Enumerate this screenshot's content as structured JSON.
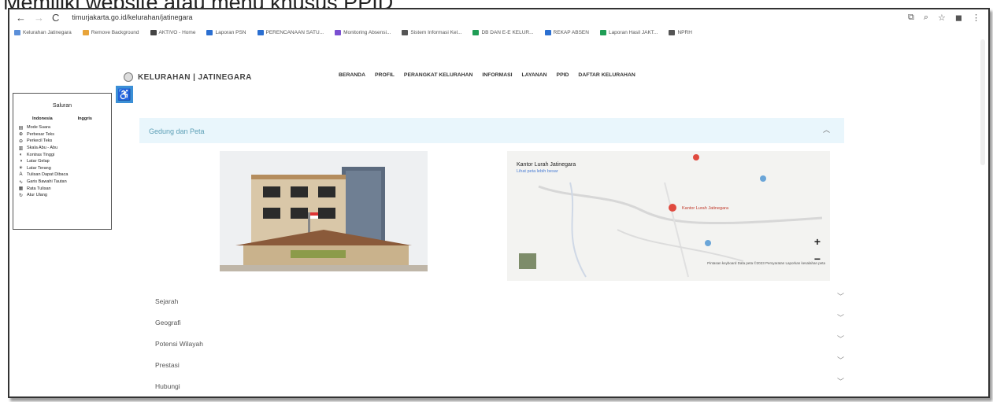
{
  "slide": {
    "title": "Memiliki website atau menu khusus PPID"
  },
  "browser": {
    "url": "timurjakarta.go.id/kelurahan/jatinegara",
    "bookmarks": [
      {
        "label": "Kelurahan Jatinegara",
        "color": "#5b8fd9"
      },
      {
        "label": "Remove Background",
        "color": "#e8a43a"
      },
      {
        "label": "AKTIVO - Home",
        "color": "#444444"
      },
      {
        "label": "Laporan PSN",
        "color": "#2b6fd1"
      },
      {
        "label": "PERENCANAAN SATU...",
        "color": "#2b6fd1"
      },
      {
        "label": "Monitoring Absensi...",
        "color": "#7a4fd1"
      },
      {
        "label": "Sistem Informasi Kel...",
        "color": "#555555"
      },
      {
        "label": "DB DAN E-E KELUR...",
        "color": "#1f9d55"
      },
      {
        "label": "REKAP ABSEN",
        "color": "#2b6fd1"
      },
      {
        "label": "Laporan Hasil JAKT...",
        "color": "#1f9d55"
      },
      {
        "label": "NPRH",
        "color": "#555555"
      }
    ]
  },
  "site": {
    "brand": "KELURAHAN | JATINEGARA",
    "menu": [
      "BERANDA",
      "PROFIL",
      "PERANGKAT KELURAHAN",
      "INFORMASI",
      "LAYANAN",
      "PPID",
      "DAFTAR KELURAHAN"
    ]
  },
  "accessibility": {
    "title": "Saluran",
    "languages": [
      "Indonesia",
      "Inggris"
    ],
    "items": [
      {
        "icon": "▤",
        "label": "Mode Suara"
      },
      {
        "icon": "⊕",
        "label": "Perbesar Teks"
      },
      {
        "icon": "⊖",
        "label": "Perkecil Teks"
      },
      {
        "icon": "▥",
        "label": "Skala Abu - Abu"
      },
      {
        "icon": "◐",
        "label": "Kontras Tinggi"
      },
      {
        "icon": "◑",
        "label": "Latar Gelap"
      },
      {
        "icon": "☀",
        "label": "Latar Terang"
      },
      {
        "icon": "A",
        "label": "Tulisan Dapat Dibaca"
      },
      {
        "icon": "∿",
        "label": "Garis Bawahi Tautan"
      },
      {
        "icon": "▦",
        "label": "Rata Tulisan"
      },
      {
        "icon": "↻",
        "label": "Atur Ulang"
      }
    ]
  },
  "main": {
    "section_label": "Gedung dan Peta",
    "map": {
      "place_title": "Kantor Lurah Jatinegara",
      "place_link": "Lihat peta lebih besar",
      "marker_label": "Kantor Lurah Jatinegara",
      "footer": "Pintasan keyboard   Data peta ©2023   Persyaratan   Laporkan kesalahan peta"
    },
    "accordion": [
      "Sejarah",
      "Geografi",
      "Potensi Wilayah",
      "Prestasi",
      "Hubungi"
    ]
  }
}
